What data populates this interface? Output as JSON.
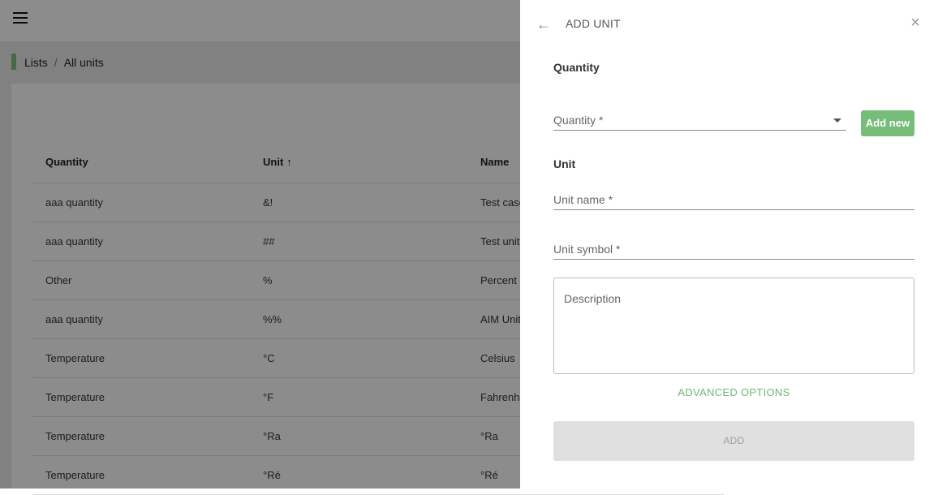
{
  "breadcrumb": {
    "root": "Lists",
    "separator": "/",
    "current": "All units"
  },
  "table": {
    "headers": {
      "quantity": "Quantity",
      "unit": "Unit",
      "name": "Name",
      "unit_sort_icon": "arrow-up-icon"
    },
    "rows": [
      {
        "quantity": "aaa quantity",
        "unit": "&!",
        "name": "Test case"
      },
      {
        "quantity": "aaa quantity",
        "unit": "##",
        "name": "Test unit"
      },
      {
        "quantity": "Other",
        "unit": "%",
        "name": "Percent"
      },
      {
        "quantity": "aaa quantity",
        "unit": "%%",
        "name": "AIM Unit"
      },
      {
        "quantity": "Temperature",
        "unit": "°C",
        "name": "Celsius"
      },
      {
        "quantity": "Temperature",
        "unit": "°F",
        "name": "Fahrenheit"
      },
      {
        "quantity": "Temperature",
        "unit": "°Ra",
        "name": "°Ra"
      },
      {
        "quantity": "Temperature",
        "unit": "°Ré",
        "name": "°Ré"
      }
    ]
  },
  "drawer": {
    "title": "ADD UNIT",
    "quantity_section": "Quantity",
    "quantity_label": "Quantity *",
    "add_new_label": "Add new",
    "unit_section": "Unit",
    "unit_name_label": "Unit name *",
    "unit_symbol_label": "Unit symbol *",
    "description_label": "Description",
    "advanced_label": "ADVANCED OPTIONS",
    "add_label": "ADD"
  },
  "colors": {
    "accent": "#76bd79",
    "accent_text": "#6fb873",
    "disabled_bg": "#e0e0e0",
    "overlay": "rgba(0,0,0,0.45)"
  }
}
